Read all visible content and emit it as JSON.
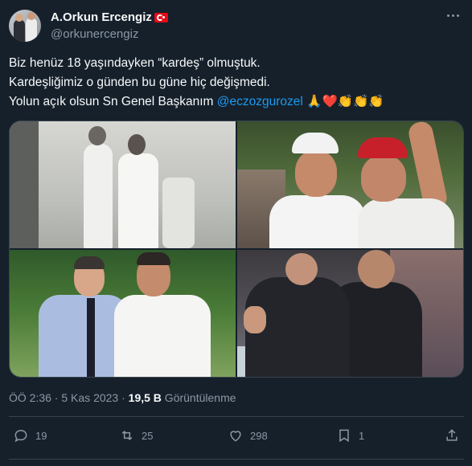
{
  "author": {
    "display_name": "A.Orkun Ercengiz",
    "flag_icon": "turkey-flag-icon",
    "handle": "@orkunercengiz"
  },
  "tweet": {
    "line1": "Biz henüz 18 yaşındayken “kardeş” olmuştuk.",
    "line2": "Kardeşliğimiz o günden bu güne hiç değişmedi.",
    "line3_prefix": "Yolun açık olsun Sn Genel Başkanım ",
    "mention": "@eczozgurozel",
    "line3_suffix": " 🙏❤️👏👏👏"
  },
  "meta": {
    "time": "ÖÖ 2:36",
    "separator": " · ",
    "date": "5 Kas 2023",
    "views_count": "19,5 B",
    "views_label": " Görüntülenme"
  },
  "actions": {
    "reply_count": "19",
    "retweet_count": "25",
    "like_count": "298",
    "bookmark_count": "1"
  },
  "colors": {
    "background": "#15202b",
    "accent": "#1d9bf0",
    "secondary_text": "#8b98a5",
    "border": "#38444d"
  }
}
